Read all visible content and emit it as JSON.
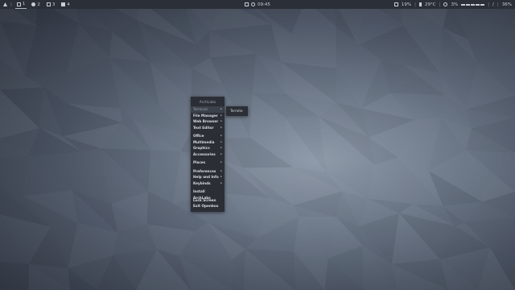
{
  "panel": {
    "workspaces": [
      {
        "num": "1",
        "icon": "terminal-icon",
        "active": true
      },
      {
        "num": "2",
        "icon": "browser-icon",
        "active": false
      },
      {
        "num": "3",
        "icon": "folder-icon",
        "active": false
      },
      {
        "num": "4",
        "icon": "document-icon",
        "active": false
      }
    ],
    "clock": "09:45",
    "disk": "19%",
    "temperature": "29°C",
    "cpu": "3%",
    "volume": "36%"
  },
  "menu": {
    "title": "ArchLabs",
    "groups": [
      [
        {
          "label": "Terminal",
          "has_submenu": true,
          "highlighted": true
        },
        {
          "label": "File Manager",
          "has_submenu": true,
          "highlighted": false
        },
        {
          "label": "Web Browser",
          "has_submenu": true,
          "highlighted": false
        },
        {
          "label": "Text Editor",
          "has_submenu": true,
          "highlighted": false
        }
      ],
      [
        {
          "label": "Office",
          "has_submenu": true,
          "highlighted": false
        },
        {
          "label": "Multimedia",
          "has_submenu": true,
          "highlighted": false
        },
        {
          "label": "Graphics",
          "has_submenu": true,
          "highlighted": false
        },
        {
          "label": "Accessories",
          "has_submenu": true,
          "highlighted": false
        }
      ],
      [
        {
          "label": "Places",
          "has_submenu": true,
          "highlighted": false
        }
      ],
      [
        {
          "label": "Preferences",
          "has_submenu": true,
          "highlighted": false
        },
        {
          "label": "Help and Info",
          "has_submenu": true,
          "highlighted": false
        },
        {
          "label": "Keybinds",
          "has_submenu": true,
          "highlighted": false
        }
      ],
      [
        {
          "label": "Install ArchLabs",
          "has_submenu": false,
          "highlighted": false
        }
      ],
      [
        {
          "label": "Lock Screen",
          "has_submenu": false,
          "highlighted": false
        },
        {
          "label": "Exit Openbox",
          "has_submenu": false,
          "highlighted": false
        }
      ]
    ]
  },
  "submenu": {
    "items": [
      "Termite"
    ]
  },
  "colors": {
    "panel_bg": "#2b2f37",
    "menu_bg": "#2b2e35",
    "highlight": "#3c414b"
  }
}
